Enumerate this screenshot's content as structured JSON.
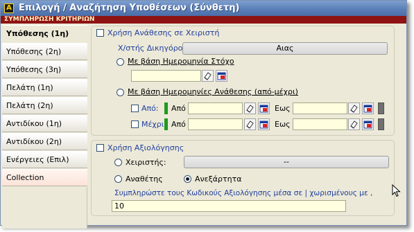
{
  "window": {
    "title": "Επιλογή / Αναζήτηση Υποθέσεων (Σύνθετη)",
    "app_icon_letter": "A",
    "subtitle": "ΣΥΜΠΛΗΡΩΣΗ ΚΡΙΤΗΡΙΩΝ"
  },
  "sidebar": {
    "items": [
      {
        "label": "Υπόθεσης (1η)",
        "active": true
      },
      {
        "label": "Υπόθεσης (2η)"
      },
      {
        "label": "Υπόθεσης (3η)"
      },
      {
        "label": "Πελάτη (1η)"
      },
      {
        "label": "Πελάτη (2η)"
      },
      {
        "label": "Αντιδίκου (1η)"
      },
      {
        "label": "Αντιδίκου (2η)"
      },
      {
        "label": "Ενέργειες (Επιλ)"
      },
      {
        "label": "Collection"
      }
    ]
  },
  "assignment": {
    "checkbox_label": "Χρήση  Ανάθεσης σε Χειριστή",
    "handler_label": "Χ/στής Δικηγόρος:",
    "handler_value": "Αιας",
    "radio_target_label": "Με βάση Ημερομηνία Στόχο",
    "radio_range_label": "Με βάση Ημερομηνίες Ανάθεσης (από-μέχρι)",
    "from_check_label": "Από:",
    "to_check_label": "Μέχρι:",
    "from_label": "Από",
    "to_label": "Εως"
  },
  "evaluation": {
    "checkbox_label": "Χρήση Αξιολόγησης",
    "handler_radio_label": "Χειριστής:",
    "handler_value": "--",
    "assignee_label": "Αναθέτης",
    "independent_label": "Ανεξάρτητα",
    "selected_radio": "independent",
    "hint_text": "Συμπληρώστε τους Κωδικούς Αξιολόγησης μέσα σε | χωρισμένους με ,",
    "codes_value": "10"
  },
  "icons": {
    "eraser": "eraser-icon",
    "calendar": "calendar-icon",
    "cursor": "mouse-pointer-icon"
  },
  "colors": {
    "title_bar": "#5b7fb8",
    "subtitle_strip": "#8e1414",
    "input_background": "#ffffe0",
    "label_blue": "#1f3e9e",
    "green_marker": "#1f9a1f"
  }
}
